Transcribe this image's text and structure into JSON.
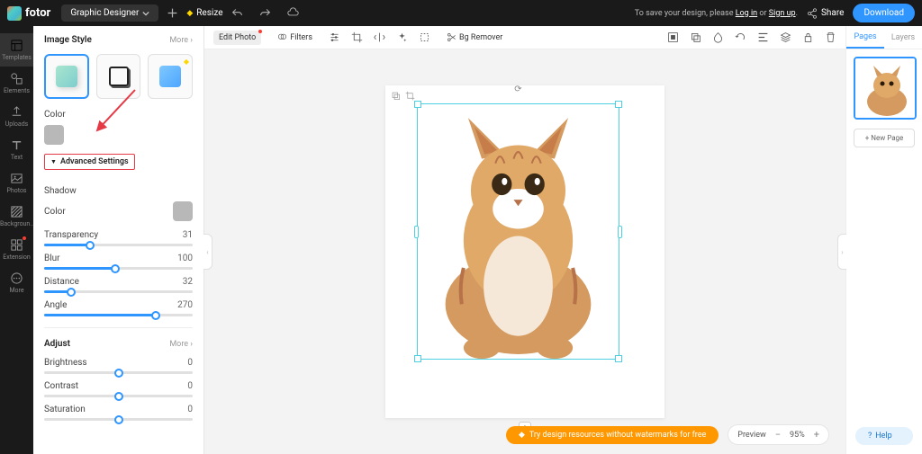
{
  "header": {
    "brand": "fotor",
    "designer": "Graphic Designer",
    "resize": "Resize",
    "save_prompt_pre": "To save your design, please ",
    "login": "Log in",
    "or": " or ",
    "signup": "Sign up",
    "dot": ".",
    "share": "Share",
    "download": "Download"
  },
  "rail": {
    "templates": "Templates",
    "elements": "Elements",
    "uploads": "Uploads",
    "text": "Text",
    "photos": "Photos",
    "background": "Backgroun..",
    "extension": "Extension",
    "more": "More"
  },
  "sidebar": {
    "image_style": "Image Style",
    "more": "More",
    "color": "Color",
    "adv": "Advanced Settings",
    "shadow": "Shadow",
    "shadow_color": "#b8b8b8",
    "sliders": {
      "transparency": {
        "label": "Transparency",
        "value": 31,
        "max": 100
      },
      "blur": {
        "label": "Blur",
        "value": 100,
        "max": 100
      },
      "distance": {
        "label": "Distance",
        "value": 32,
        "max": 100
      },
      "angle": {
        "label": "Angle",
        "value": 270,
        "max": 360
      }
    },
    "adjust": "Adjust",
    "adjust_sliders": {
      "brightness": {
        "label": "Brightness",
        "value": 0
      },
      "contrast": {
        "label": "Contrast",
        "value": 0
      },
      "saturation": {
        "label": "Saturation",
        "value": 0
      }
    }
  },
  "toolbar": {
    "edit_photo": "Edit Photo",
    "filters": "Filters",
    "bg_remover": "Bg Remover"
  },
  "right": {
    "pages": "Pages",
    "layers": "Layers",
    "new_page": "+ New Page"
  },
  "bottom": {
    "promo": "Try design resources without watermarks for free",
    "preview": "Preview",
    "zoom": "95%",
    "help": "Help"
  },
  "colors": {
    "accent": "#2f95ff",
    "annotation": "#e63946"
  }
}
